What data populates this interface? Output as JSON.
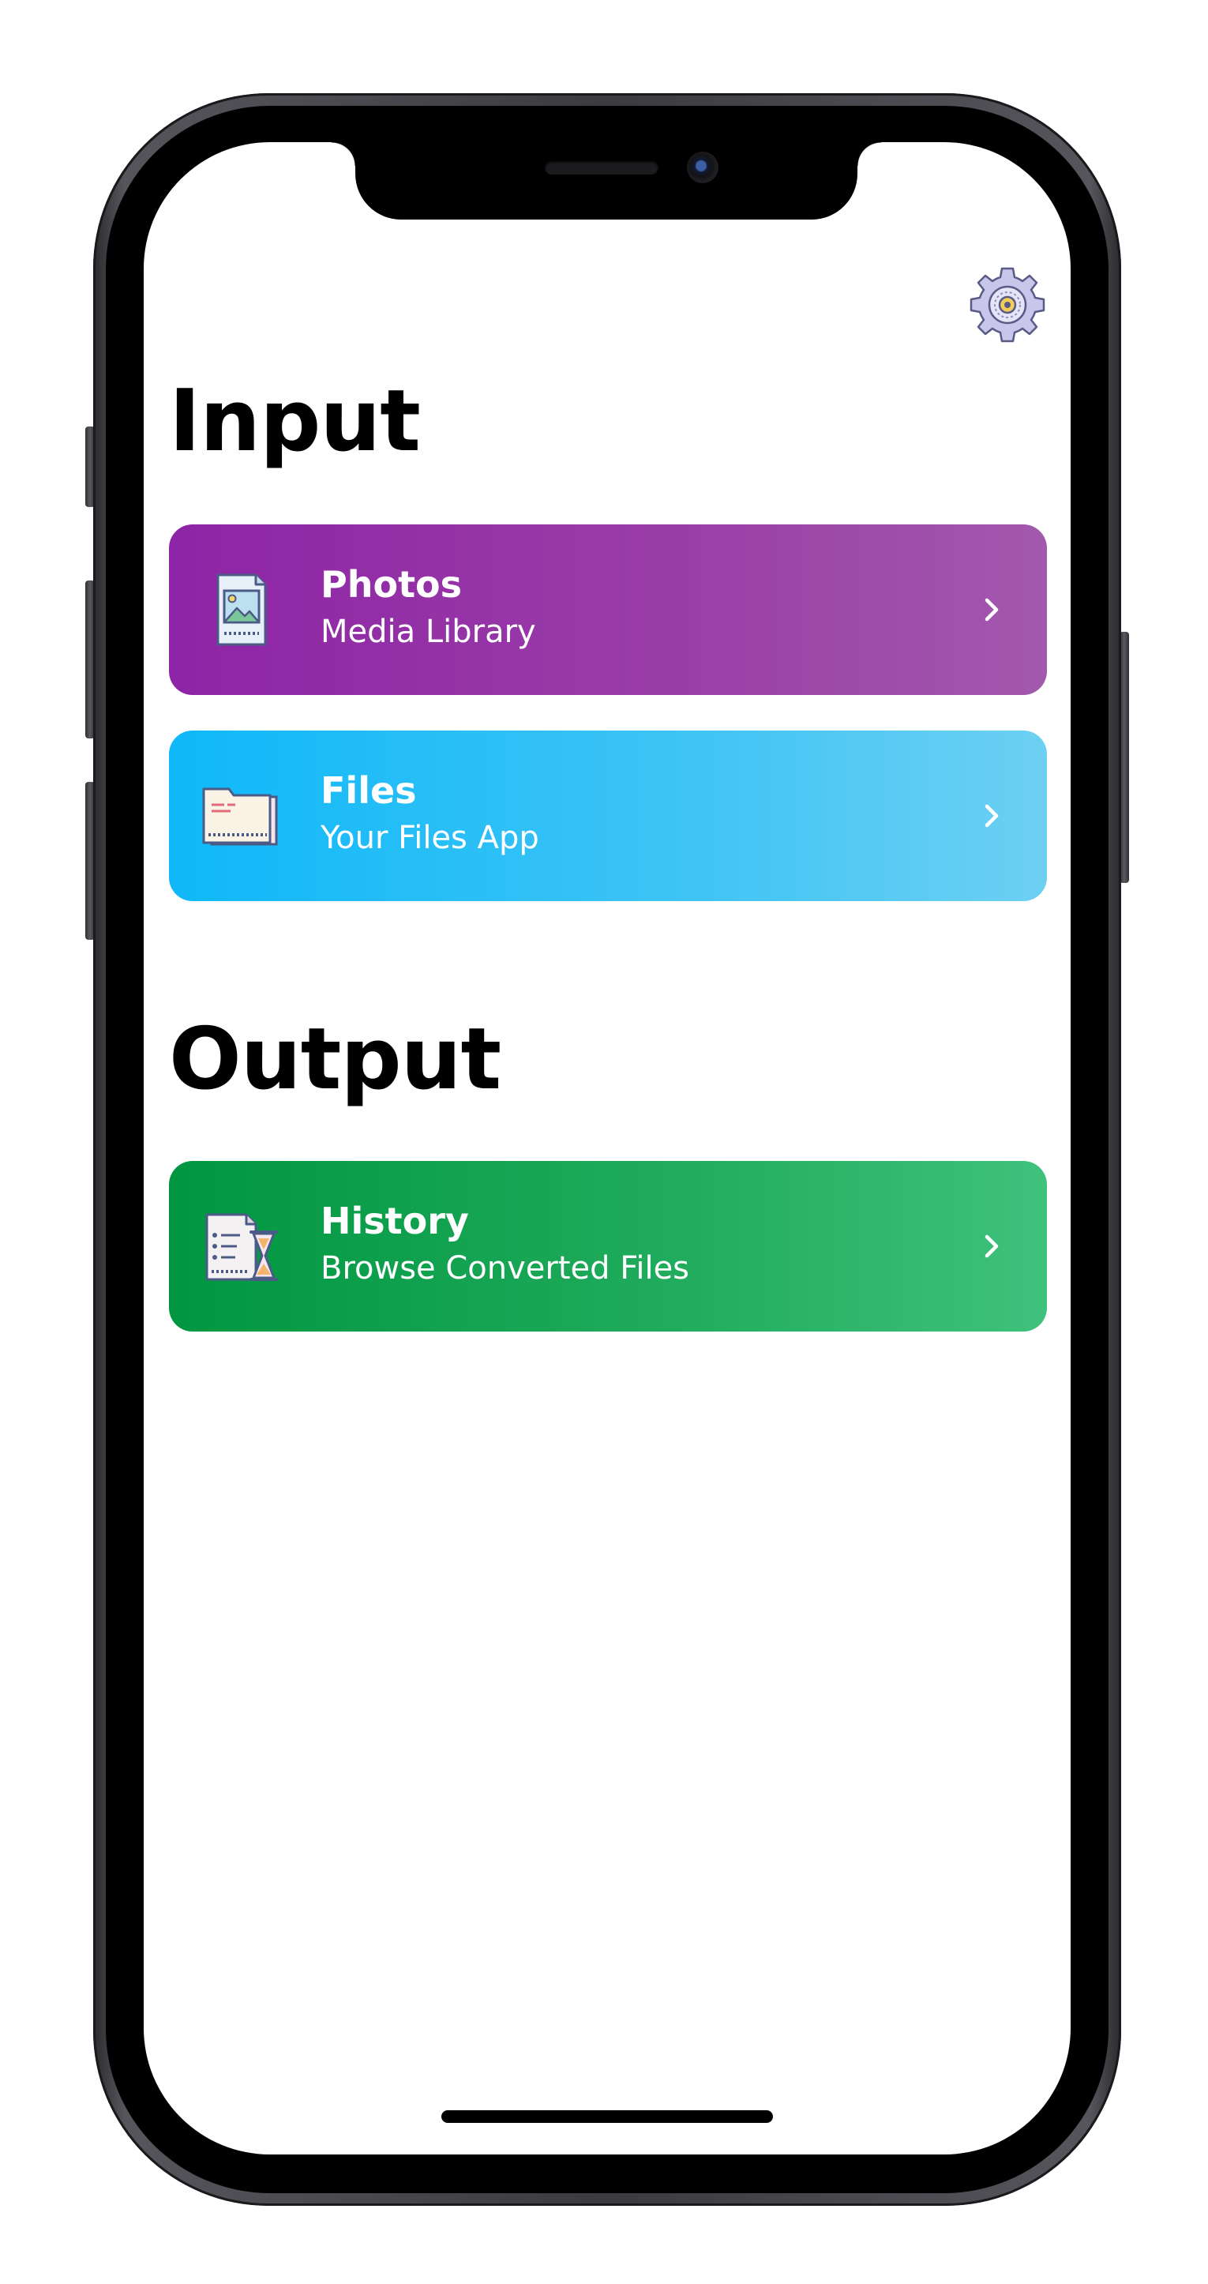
{
  "settings": {
    "icon": "gear-icon"
  },
  "sections": {
    "input": {
      "title": "Input",
      "cards": [
        {
          "title": "Photos",
          "subtitle": "Media Library",
          "icon": "photo-document-icon",
          "gradient": [
            "#8e24a6",
            "#a259ad"
          ]
        },
        {
          "title": "Files",
          "subtitle": "Your Files App",
          "icon": "folder-icon",
          "gradient": [
            "#0fb8f8",
            "#6dd0f2"
          ]
        }
      ]
    },
    "output": {
      "title": "Output",
      "cards": [
        {
          "title": "History",
          "subtitle": "Browse Converted Files",
          "icon": "history-document-icon",
          "gradient": [
            "#009640",
            "#3fc27c"
          ]
        }
      ]
    }
  },
  "colors": {
    "text_heading": "#000000",
    "text_on_card": "#ffffff",
    "screen_background": "#ffffff"
  }
}
